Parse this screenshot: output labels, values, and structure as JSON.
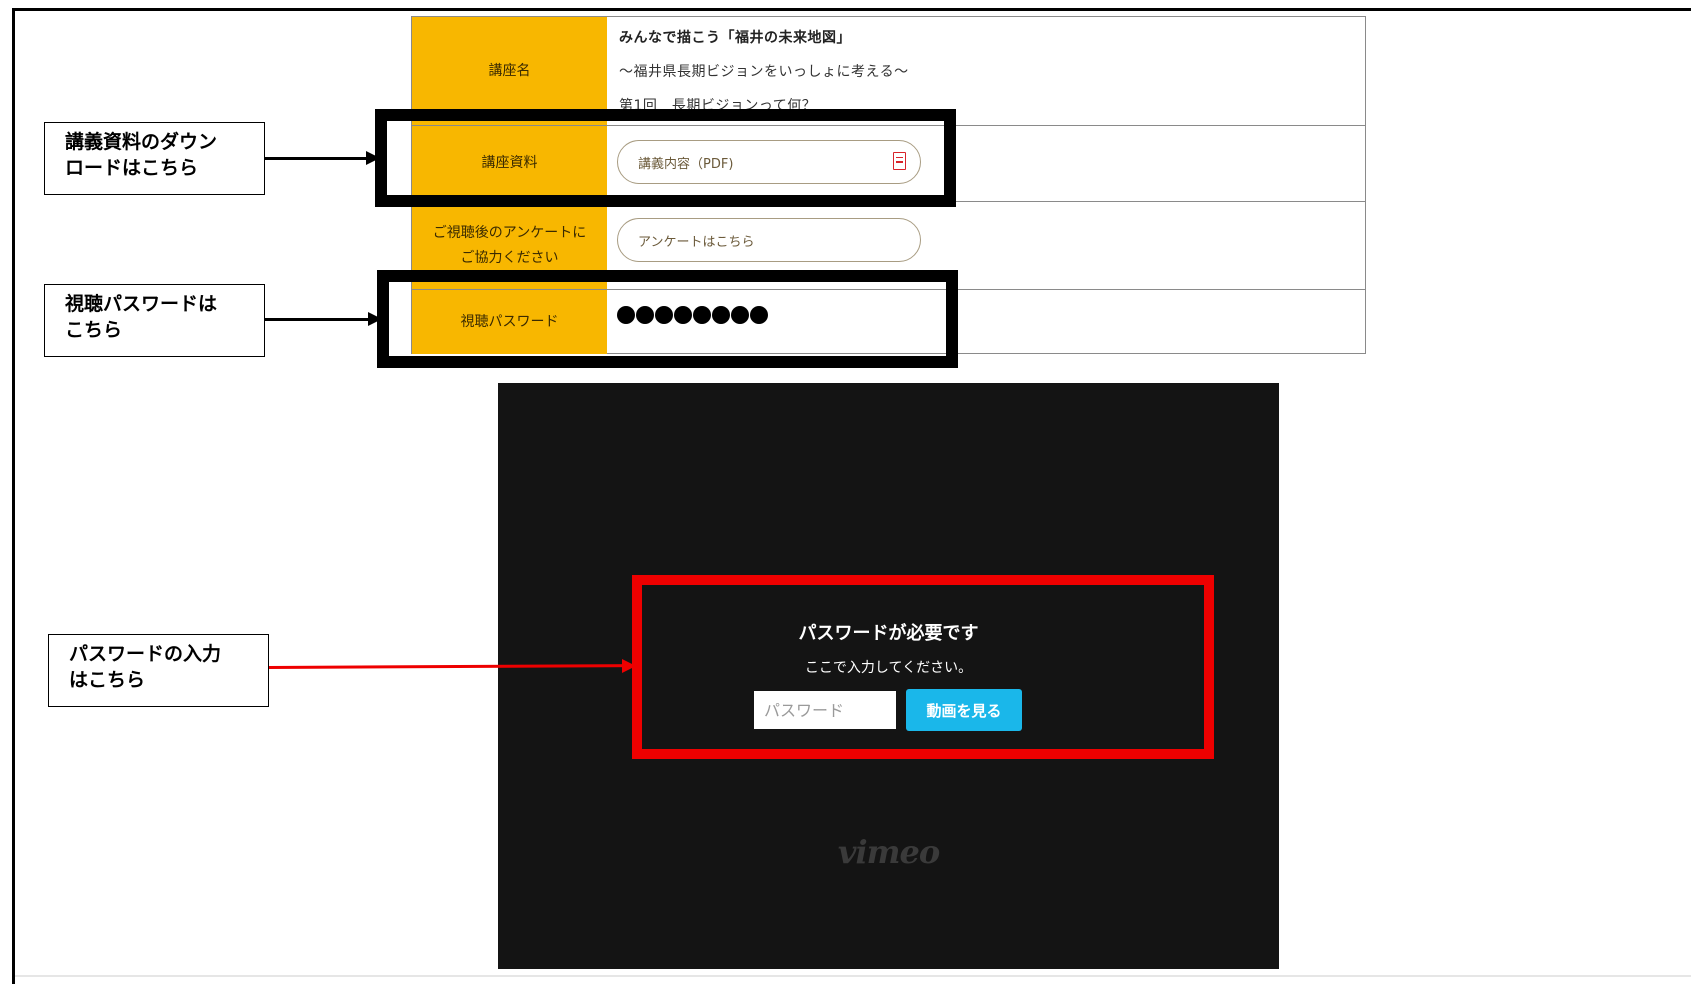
{
  "info_table": {
    "course_name": {
      "label": "講座名",
      "lines": [
        "みんなで描こう「福井の未来地図」",
        "～福井県長期ビジョンをいっしょに考える～",
        "第1回　長期ビジョンって何？"
      ]
    },
    "course_material": {
      "label": "講座資料",
      "button_label": "講義内容（PDF)",
      "icon": "pdf-icon"
    },
    "survey": {
      "label_line1": "ご視聴後のアンケートに",
      "label_line2": "ご協力ください",
      "button_label": "アンケートはこちら"
    },
    "viewing_password": {
      "label": "視聴パスワード",
      "masked_dot_count": 8
    }
  },
  "callouts": {
    "download": {
      "line1": "講義資料のダウン",
      "line2": "ロードはこちら"
    },
    "password": {
      "line1": "視聴パスワードは",
      "line2": "こちら"
    },
    "password_input": {
      "line1": "パスワードの入力",
      "line2": "はこちら"
    }
  },
  "player": {
    "title": "パスワードが必要です",
    "subtitle": "ここで入力してください。",
    "input_placeholder": "パスワード",
    "submit_label": "動画を見る",
    "logo": "vimeo"
  },
  "colors": {
    "table_header_bg": "#f8b700",
    "highlight_black": "#000000",
    "highlight_red": "#ee0000",
    "player_bg": "#141414",
    "submit_button": "#1ab7ea"
  }
}
